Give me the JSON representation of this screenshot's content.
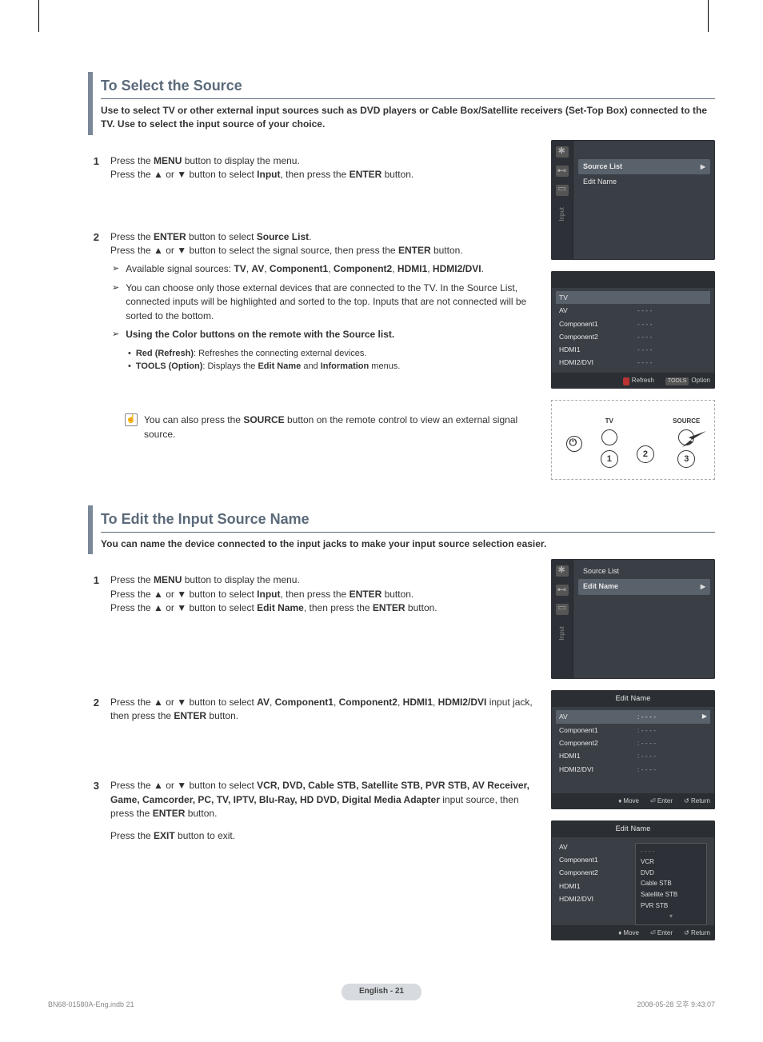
{
  "section1": {
    "title": "To Select the Source",
    "intro": "Use to select TV or other external input sources such as DVD players or Cable Box/Satellite receivers (Set-Top Box) connected to the TV. Use to select the input source of your choice.",
    "step1_a": "Press the ",
    "step1_b": "MENU",
    "step1_c": " button to display the menu.",
    "step1_d": "Press the ▲ or ▼ button to select ",
    "step1_e": "Input",
    "step1_f": ", then press the ",
    "step1_g": "ENTER",
    "step1_h": " button.",
    "step2_a": "Press the ",
    "step2_b": "ENTER",
    "step2_c": " button to select ",
    "step2_d": "Source List",
    "step2_e": ".",
    "step2_f": "Press the ▲ or ▼ button to select the signal source, then press the ",
    "step2_g": "ENTER",
    "step2_h": " button.",
    "arrow1_a": "Available signal sources: ",
    "arrow1_b": "TV",
    "arrow1_c": "AV",
    "arrow1_d": "Component1",
    "arrow1_e": "Component2",
    "arrow1_f": "HDMI1",
    "arrow1_g": "HDMI2/DVI",
    "arrow2": "You can choose only those external devices that are connected to the TV. In the Source List, connected inputs will be highlighted and sorted to the top. Inputs that are not connected will be sorted to the bottom.",
    "arrow3": "Using the Color buttons on the remote with the Source list.",
    "bullet1_a": "Red (Refresh)",
    "bullet1_b": ": Refreshes the connecting external devices.",
    "bullet2_a": "TOOLS (Option)",
    "bullet2_b": ": Displays the ",
    "bullet2_c": "Edit Name",
    "bullet2_d": " and ",
    "bullet2_e": "Information",
    "bullet2_f": " menus.",
    "note_a": "You can also press the ",
    "note_b": "SOURCE",
    "note_c": " button on the remote control to view an external signal source."
  },
  "osd_input": {
    "side_label": "Input",
    "row1": "Source List",
    "row2": "Edit Name"
  },
  "osd_sourcelist": {
    "title_hidden": "",
    "tv": "TV",
    "av": "AV",
    "comp1": "Component1",
    "comp2": "Component2",
    "hdmi1": "HDMI1",
    "hdmi2": "HDMI2/DVI",
    "dash": "- - - -",
    "refresh": "Refresh",
    "option": "Option"
  },
  "remote": {
    "tv": "TV",
    "source": "SOURCE",
    "n1": "1",
    "n2": "2",
    "n3": "3"
  },
  "section2": {
    "title": "To Edit the Input Source Name",
    "intro": "You can name the device connected to the input jacks to make your input source selection easier.",
    "step1_a": "Press the ",
    "step1_b": "MENU",
    "step1_c": " button to display the menu.",
    "step1_d": "Press the ▲ or ▼ button to select ",
    "step1_e": "Input",
    "step1_f": ", then press the ",
    "step1_g": "ENTER",
    "step1_h": " button.",
    "step1_i": "Press the ▲ or ▼ button to select ",
    "step1_j": "Edit Name",
    "step1_k": ", then press the ",
    "step1_l": "ENTER",
    "step1_m": " button.",
    "step2_a": "Press the ▲ or ▼ button to select ",
    "step2_b": "AV",
    "step2_c": "Component1",
    "step2_d": "Component2",
    "step2_e": "HDMI1",
    "step2_f": "HDMI2/DVI",
    "step2_g": " input jack, then press the ",
    "step2_h": "ENTER",
    "step2_i": " button.",
    "step3_a": "Press the ▲ or ▼ button to select ",
    "step3_b": "VCR, DVD, Cable STB, Satellite STB, PVR STB, AV Receiver, Game, Camcorder, PC, TV, IPTV, Blu-Ray, HD DVD, Digital Media Adapter",
    "step3_c": " input source, then press the ",
    "step3_d": "ENTER",
    "step3_e": " button.",
    "step3_f": "Press the ",
    "step3_g": "EXIT",
    "step3_h": " button to exit."
  },
  "osd_input2": {
    "side_label": "Input",
    "row1": "Source List",
    "row2": "Edit Name"
  },
  "osd_editname": {
    "title": "Edit Name",
    "av": "AV",
    "comp1": "Component1",
    "comp2": "Component2",
    "hdmi1": "HDMI1",
    "hdmi2": "HDMI2/DVI",
    "dash": ": - - - -",
    "move": "Move",
    "enter": "Enter",
    "return": "Return"
  },
  "osd_editname_popup": {
    "title": "Edit Name",
    "av": "AV",
    "comp1": "Component1",
    "comp2": "Component2",
    "hdmi1": "HDMI1",
    "hdmi2": "HDMI2/DVI",
    "opt_blank": "- - - -",
    "opt_vcr": "VCR",
    "opt_dvd": "DVD",
    "opt_cable": "Cable STB",
    "opt_sat": "Satellite STB",
    "opt_pvr": "PVR STB",
    "move": "Move",
    "enter": "Enter",
    "return": "Return"
  },
  "page_badge": "English - 21",
  "footer_left": "BN68-01580A-Eng.indb   21",
  "footer_right": "2008-05-28   오후 9:43:07"
}
